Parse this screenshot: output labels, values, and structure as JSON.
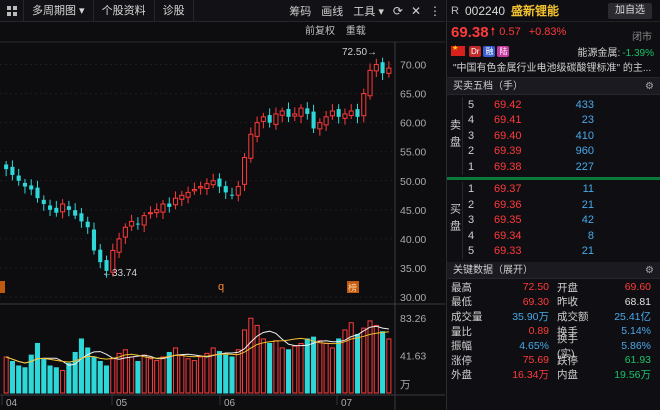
{
  "toolbar": {
    "buttons": [
      "多周期图",
      "个股资料",
      "诊股"
    ],
    "right": [
      "筹码",
      "画线",
      "工具"
    ]
  },
  "subbar": {
    "adjust": "前复权",
    "overlay": "重载"
  },
  "chart": {
    "price_axis": [
      "70.00",
      "65.00",
      "60.00",
      "55.00",
      "50.00",
      "45.00",
      "40.00",
      "35.00",
      "30.00"
    ],
    "vol_axis": [
      "83.26",
      "41.63",
      "万"
    ],
    "month_labels": [
      "04",
      "05",
      "06",
      "07"
    ],
    "high_label": "72.50",
    "low_label": "33.74",
    "markers": [
      "q",
      "榜"
    ]
  },
  "chart_data": {
    "type": "candlestick",
    "ylim": [
      30,
      72.5
    ],
    "closes": [
      52,
      51,
      50,
      49,
      48.5,
      47,
      46,
      45,
      44.5,
      46,
      45,
      44,
      43,
      42,
      38,
      36,
      34.5,
      38,
      40,
      42,
      43,
      42.5,
      44,
      44.5,
      45,
      46,
      45.5,
      47,
      47.5,
      48,
      48.5,
      49,
      49.5,
      50,
      49,
      48,
      47.5,
      49,
      54,
      58,
      60,
      61,
      60,
      61.5,
      62,
      61,
      61.5,
      62.5,
      61.5,
      59,
      60,
      61,
      62,
      61,
      61.5,
      62,
      61,
      65,
      69,
      70,
      68.5,
      69.38
    ],
    "volumes": [
      40,
      35,
      30,
      28,
      42,
      55,
      38,
      30,
      28,
      25,
      33,
      45,
      60,
      50,
      40,
      35,
      30,
      38,
      44,
      48,
      40,
      35,
      42,
      38,
      36,
      40,
      45,
      50,
      42,
      38,
      36,
      40,
      44,
      50,
      46,
      42,
      40,
      48,
      70,
      83,
      75,
      60,
      55,
      58,
      50,
      48,
      52,
      55,
      60,
      62,
      58,
      55,
      50,
      60,
      70,
      78,
      65,
      72,
      80,
      75,
      68,
      60
    ]
  },
  "stock": {
    "r": "R",
    "code": "002240",
    "name": "盛新锂能",
    "add_btn": "加自选",
    "price": "69.38",
    "change": "0.57",
    "change_pct": "+0.83%",
    "status": "闭市",
    "tags": [
      "Dr",
      "融",
      "陆"
    ],
    "sector": "能源金属:",
    "sector_pct": "-1.39%",
    "concept": "\"中国有色金属行业电池级碳酸锂标准\" 的主..."
  },
  "orderbook": {
    "title": "买卖五档（手）",
    "sell_label": "卖盘",
    "buy_label": "买盘",
    "sells": [
      {
        "lv": "5",
        "price": "69.42",
        "vol": "433"
      },
      {
        "lv": "4",
        "price": "69.41",
        "vol": "23"
      },
      {
        "lv": "3",
        "price": "69.40",
        "vol": "410"
      },
      {
        "lv": "2",
        "price": "69.39",
        "vol": "960"
      },
      {
        "lv": "1",
        "price": "69.38",
        "vol": "227"
      }
    ],
    "buys": [
      {
        "lv": "1",
        "price": "69.37",
        "vol": "11"
      },
      {
        "lv": "2",
        "price": "69.36",
        "vol": "21"
      },
      {
        "lv": "3",
        "price": "69.35",
        "vol": "42"
      },
      {
        "lv": "4",
        "price": "69.34",
        "vol": "8"
      },
      {
        "lv": "5",
        "price": "69.33",
        "vol": "21"
      }
    ]
  },
  "keydata": {
    "title": "关键数据（展开）",
    "rows": [
      {
        "l1": "最高",
        "v1": "72.50",
        "c1": "red",
        "l2": "开盘",
        "v2": "69.60",
        "c2": "red"
      },
      {
        "l1": "最低",
        "v1": "69.30",
        "c1": "red",
        "l2": "昨收",
        "v2": "68.81",
        "c2": "white"
      },
      {
        "l1": "成交量",
        "v1": "35.90万",
        "c1": "cyan",
        "l2": "成交额",
        "v2": "25.41亿",
        "c2": "cyan"
      },
      {
        "l1": "量比",
        "v1": "0.89",
        "c1": "red",
        "l2": "换手",
        "v2": "5.14%",
        "c2": "cyan"
      },
      {
        "l1": "振幅",
        "v1": "4.65%",
        "c1": "cyan",
        "l2": "换手(实)",
        "v2": "5.86%",
        "c2": "cyan"
      },
      {
        "l1": "涨停",
        "v1": "75.69",
        "c1": "red",
        "l2": "跌停",
        "v2": "61.93",
        "c2": "green"
      },
      {
        "l1": "外盘",
        "v1": "16.34万",
        "c1": "red",
        "l2": "内盘",
        "v2": "19.56万",
        "c2": "green"
      }
    ]
  }
}
